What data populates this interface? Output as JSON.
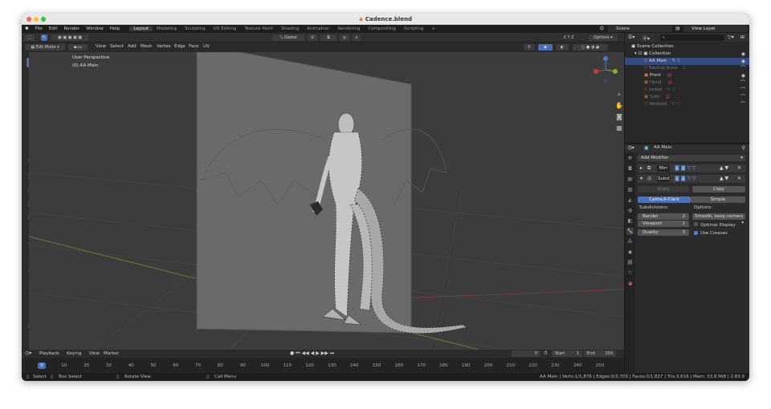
{
  "window": {
    "title": "Cadence.blend"
  },
  "menubar": {
    "items": [
      "File",
      "Edit",
      "Render",
      "Window",
      "Help"
    ],
    "workspaces": [
      "Layout",
      "Modeling",
      "Sculpting",
      "UV Editing",
      "Texture Paint",
      "Shading",
      "Animation",
      "Rendering",
      "Compositing",
      "Scripting"
    ],
    "active_workspace": "Layout",
    "add_tab": "+",
    "scene_name": "Scene",
    "view_layer": "View Layer"
  },
  "viewport_header": {
    "orientation": "Global",
    "options": "Options",
    "axes": [
      "X",
      "Y",
      "Z"
    ],
    "mode": "Edit Mode",
    "menus": [
      "View",
      "Select",
      "Add",
      "Mesh",
      "Vertex",
      "Edge",
      "Face",
      "UV"
    ]
  },
  "viewport": {
    "perspective": "User Perspective",
    "object_label": "(0) AA Main",
    "colors": {
      "background": "#3c3c3c",
      "plane": "#6a6a6a",
      "grid": "#474747",
      "x_axis": "#8a3a3a",
      "y_axis": "#7b8a2a",
      "mesh": "#bdbdbd",
      "edge": "#111111"
    }
  },
  "timeline": {
    "menus": [
      "Playback",
      "Keying",
      "View",
      "Marker"
    ],
    "current_frame": "0",
    "start_label": "Start",
    "start": "1",
    "end_label": "End",
    "end": "250",
    "frames": [
      "0",
      "10",
      "20",
      "30",
      "40",
      "50",
      "60",
      "70",
      "80",
      "90",
      "100",
      "110",
      "120",
      "130",
      "140",
      "150",
      "160",
      "170",
      "180",
      "190",
      "200",
      "210",
      "220",
      "230",
      "240",
      "250"
    ]
  },
  "statusbar": {
    "select": "Select",
    "box_select": "Box Select",
    "rotate_view": "Rotate View",
    "call_menu": "Call Menu",
    "stats": "AA Main | Verts:1/1,876 | Edges:0/3,703 | Faces:0/1,827 | Tris:3,616 | Mem: 33.8 MiB | 2.83.9"
  },
  "outliner": {
    "scene_collection": "Scene Collection",
    "collection": "Collection",
    "items": [
      {
        "label": "AA Main",
        "selected": true,
        "hidden": false
      },
      {
        "label": "Backup bone",
        "selected": false,
        "hidden": true
      },
      {
        "label": "Front",
        "selected": false,
        "hidden": false
      },
      {
        "label": "Hand",
        "selected": false,
        "hidden": true
      },
      {
        "label": "Jacket",
        "selected": false,
        "hidden": true
      },
      {
        "label": "Side",
        "selected": false,
        "hidden": true
      },
      {
        "label": "Webbed",
        "selected": false,
        "hidden": true
      }
    ]
  },
  "properties": {
    "object_name": "AA Main",
    "add_modifier": "Add Modifier",
    "modifier_mirror": "Mirr",
    "modifier_subsurf": "Subd",
    "apply": "Apply",
    "copy": "Copy",
    "catmull_clark": "Catmull-Clark",
    "simple": "Simple",
    "subdivisions": "Subdivisions:",
    "options": "Options:",
    "render_label": "Render",
    "render_value": "2",
    "viewport_label": "Viewport",
    "viewport_value": "1",
    "quality_label": "Quality",
    "quality_value": "3",
    "uv_smooth": "Smooth, keep corners",
    "optimal_display": "Optimal Display",
    "use_creases": "Use Creases",
    "colors": {
      "accent": "#4a70b8"
    }
  }
}
